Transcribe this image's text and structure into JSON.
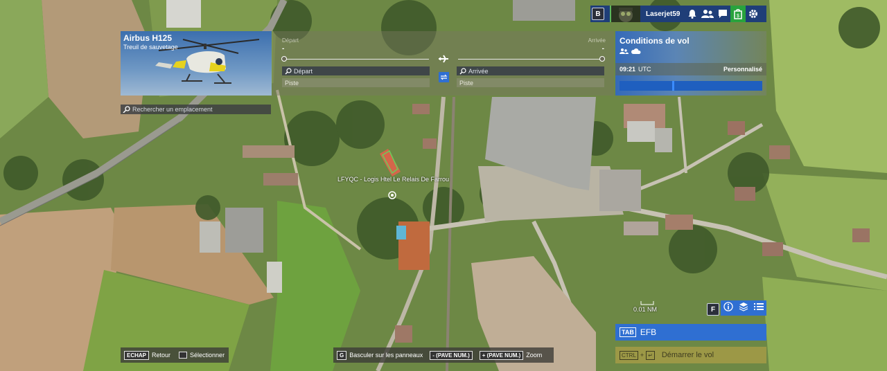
{
  "topbar": {
    "key_b": "B",
    "username": "Laserjet59",
    "icons": [
      "bell-icon",
      "friends-icon",
      "chat-icon",
      "shop-icon",
      "gear-icon"
    ]
  },
  "aircraft": {
    "name": "Airbus H125",
    "mission": "Treuil de sauvetage"
  },
  "search": {
    "placeholder": "Rechercher un emplacement"
  },
  "flight": {
    "depart_label": "Départ",
    "arrival_label": "Arrivée",
    "depart_value": "-",
    "arrival_value": "-",
    "depart_input": "Départ",
    "arrival_input": "Arrivée",
    "depart_runway": "Piste",
    "arrival_runway": "Piste"
  },
  "conditions": {
    "title": "Conditions de vol",
    "time": "09:21",
    "timezone": "UTC",
    "mode": "Personnalisé",
    "time_progress": 0.37
  },
  "map": {
    "poi_label": "LFYQC - Logis Htel Le Relais De Farrou",
    "scale_text": "0.01 NM"
  },
  "maptools": {
    "f_key": "F",
    "icons": [
      "info-icon",
      "layers-icon",
      "list-icon"
    ]
  },
  "efb": {
    "key": "TAB",
    "label": "EFB"
  },
  "start": {
    "key1": "CTRL",
    "plus": "+",
    "key2": "↵",
    "label": "Démarrer le vol"
  },
  "hints": {
    "escape_key": "ECHAP",
    "escape_label": "Retour",
    "select_label": "Sélectionner",
    "g_key": "G",
    "g_label": "Basculer sur les panneaux",
    "minus_key": "- (PAVE NUM.)",
    "plus_key": "+ (PAVE NUM.)",
    "zoom_label": "Zoom"
  },
  "colors": {
    "accent": "#2f6fd2",
    "topbar": "#1f3e78",
    "start": "#a59b46",
    "shop": "#29a33d"
  }
}
